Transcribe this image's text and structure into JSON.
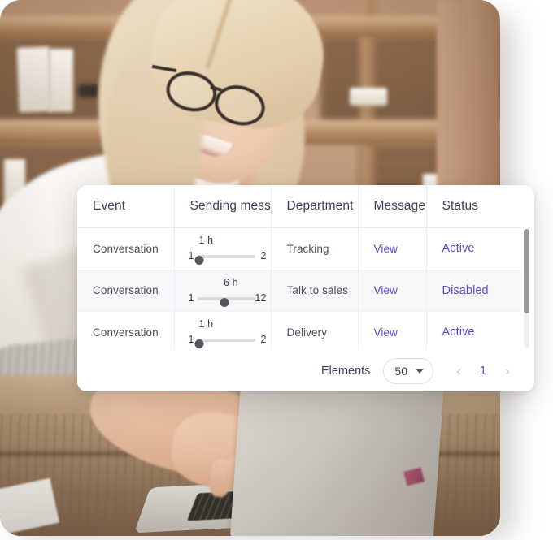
{
  "card": {
    "table": {
      "columns": [
        {
          "label": "Event",
          "name": "column-event"
        },
        {
          "label": "Sending mess",
          "name": "column-sending-message"
        },
        {
          "label": "Department",
          "name": "column-department"
        },
        {
          "label": "Message",
          "name": "column-message"
        },
        {
          "label": "Status",
          "name": "column-status"
        }
      ],
      "rows": [
        {
          "event": "Conversation",
          "slider": {
            "value": "1 h",
            "min": "1",
            "max": "2",
            "percent": 4
          },
          "department": "Tracking",
          "message_link": "View",
          "status": "Active"
        },
        {
          "event": "Conversation",
          "slider": {
            "value": "6 h",
            "min": "1",
            "max": "12",
            "percent": 47
          },
          "department": "Talk to sales",
          "message_link": "View",
          "status": "Disabled"
        },
        {
          "event": "Conversation",
          "slider": {
            "value": "1 h",
            "min": "1",
            "max": "2",
            "percent": 4
          },
          "department": "Delivery",
          "message_link": "View",
          "status": "Active"
        }
      ]
    },
    "footer": {
      "elements_label": "Elements",
      "page_size_value": "50",
      "prev_label": "‹",
      "current_page": "1",
      "next_label": "›"
    }
  },
  "colors": {
    "accent": "#5B4AE0",
    "text": "#3C4257",
    "muted": "#4A4F5E",
    "divider": "#EDEDF1",
    "row_alt": "#F7F7F9",
    "slider_track": "#DCDCE1",
    "slider_thumb": "#56565E",
    "scrollbar_thumb": "#9A9A9E",
    "card_bg": "#FFFFFF"
  }
}
